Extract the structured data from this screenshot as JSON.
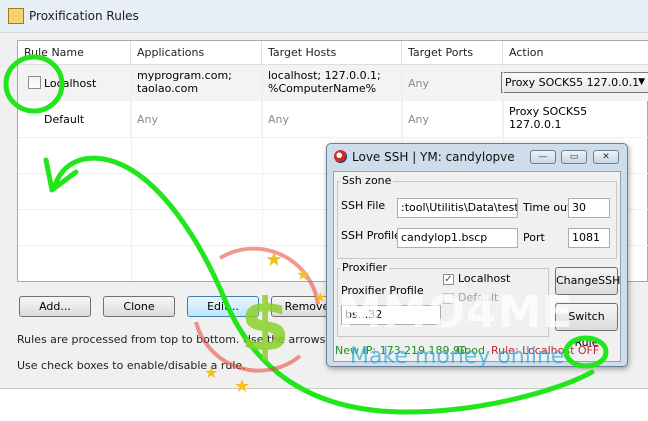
{
  "window": {
    "title": "Proxification Rules"
  },
  "table": {
    "columns": [
      "Rule Name",
      "Applications",
      "Target Hosts",
      "Target Ports",
      "Action"
    ],
    "rows": [
      {
        "name": "Localhost",
        "applications": "myprogram.com;\ntaolao.com",
        "hosts": "localhost; 127.0.0.1;\n%ComputerName%",
        "ports": "Any",
        "action": "Proxy SOCKS5 127.0.0.1"
      },
      {
        "name": "Default",
        "applications": "Any",
        "hosts": "Any",
        "ports": "Any",
        "action": "Proxy SOCKS5\n127.0.0.1"
      }
    ]
  },
  "buttons": {
    "add": "Add...",
    "clone": "Clone",
    "edit": "Edit...",
    "remove": "Remove"
  },
  "info": {
    "line1": "Rules are processed from top to bottom. Use the arrows at the r",
    "line2": "Use check boxes to enable/disable a rule."
  },
  "ssh_window": {
    "title": "Love SSH | YM: candylopve",
    "ssh_zone": {
      "label": "Ssh zone",
      "file_label": "SSH File",
      "file_value": ":tool\\Utilitis\\Data\\test.txt",
      "timeout_label": "Time out",
      "timeout_value": "30",
      "profile_label": "SSH Profile",
      "profile_value": "candylop1.bscp",
      "port_label": "Port",
      "port_value": "1081"
    },
    "proxifier": {
      "label": "Proxifier",
      "localhost_label": "Localhost",
      "default_label": "Default",
      "profile_label": "Proxifier Profile",
      "profile_value": "bs...32"
    },
    "change_ssh_button": "ChangeSSH",
    "switch_button": "Switch Rule",
    "status_ip": "New IP: 173.219.189.90",
    "status_good": "Good",
    "rule_status": "Rule: Localhost OFF"
  },
  "watermark": {
    "brand": "MMO4ME",
    "tagline": "Make money online"
  },
  "colors": {
    "annotation": "#22e61c",
    "status_ok": "#1f8f1f",
    "status_rule": "#c0282d",
    "watermark": "#2fa5d8"
  }
}
